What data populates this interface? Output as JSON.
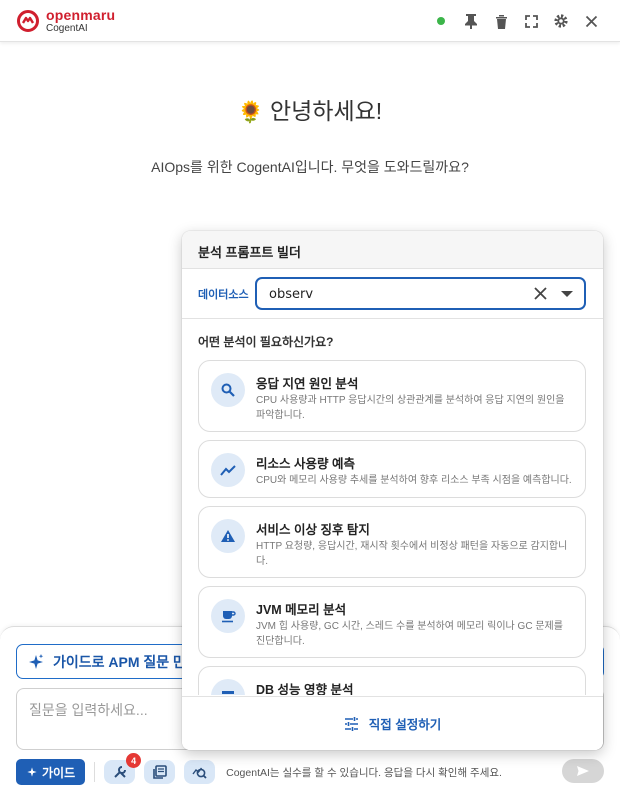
{
  "header": {
    "brand": "openmaru",
    "product": "CogentAI",
    "colors": {
      "brand_red": "#d01f2e",
      "status_green": "#3cb54a"
    },
    "icons": [
      "status-dot",
      "pin-icon",
      "trash-icon",
      "fullscreen-icon",
      "gear-icon",
      "close-icon"
    ]
  },
  "welcome": {
    "emoji": "🌻",
    "greeting": "안녕하세요!",
    "subtitle": "AIOps를 위한 CogentAI입니다. 무엇을 도와드릴까요?"
  },
  "composer": {
    "guide_apm_label": "가이드로 APM 질문 만들",
    "input_placeholder": "질문을 입력하세요...",
    "guide_button": "가이드",
    "tools_badge": "4",
    "disclaimer": "CogentAI는 실수를 할 수 있습니다. 응답을 다시 확인해 주세요."
  },
  "panel": {
    "title": "분석 프롬프트 빌더",
    "datasource_label": "데이터소스",
    "datasource_value": "observ",
    "question": "어떤 분석이 필요하신가요?",
    "cards": [
      {
        "icon": "search-icon",
        "title": "응답 지연 원인 분석",
        "desc": "CPU 사용량과 HTTP 응답시간의 상관관계를 분석하여 응답 지연의 원인을 파악합니다."
      },
      {
        "icon": "trend-icon",
        "title": "리소스 사용량 예측",
        "desc": "CPU와 메모리 사용량 추세를 분석하여 향후 리소스 부족 시점을 예측합니다."
      },
      {
        "icon": "warning-icon",
        "title": "서비스 이상 징후 탐지",
        "desc": "HTTP 요청량, 응답시간, 재시작 횟수에서 비정상 패턴을 자동으로 감지합니다."
      },
      {
        "icon": "coffee-icon",
        "title": "JVM 메모리 분석",
        "desc": "JVM 힙 사용량, GC 시간, 스레드 수를 분석하여 메모리 릭이나 GC 문제를 진단합니다."
      },
      {
        "icon": "database-icon",
        "title": "DB 성능 영향 분석",
        "desc": ""
      }
    ],
    "footer": "직접 설정하기"
  }
}
